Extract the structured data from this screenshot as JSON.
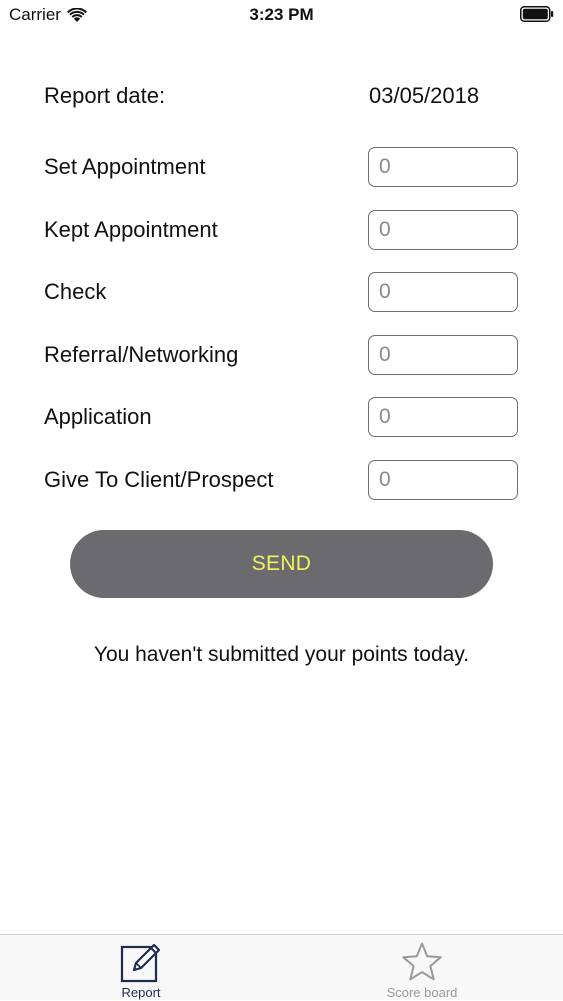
{
  "status_bar": {
    "carrier": "Carrier",
    "time": "3:23 PM"
  },
  "report": {
    "date_label": "Report date:",
    "date_value": "03/05/2018",
    "fields": [
      {
        "label": "Set Appointment",
        "value": "0"
      },
      {
        "label": "Kept Appointment",
        "value": "0"
      },
      {
        "label": "Check",
        "value": "0"
      },
      {
        "label": "Referral/Networking",
        "value": "0"
      },
      {
        "label": "Application",
        "value": "0"
      },
      {
        "label": "Give To Client/Prospect",
        "value": "0"
      }
    ]
  },
  "send_button": {
    "label": "SEND",
    "background": "#6b6a6f",
    "text_color": "#f3f35a"
  },
  "status_message": "You haven't submitted your points today.",
  "tab_bar": {
    "tabs": [
      {
        "label": "Report",
        "icon": "report-edit-icon",
        "selected": true
      },
      {
        "label": "Score board",
        "icon": "star-icon",
        "selected": false
      }
    ],
    "selected_color": "#1d2b4f",
    "unselected_color": "#9a9a9a"
  }
}
